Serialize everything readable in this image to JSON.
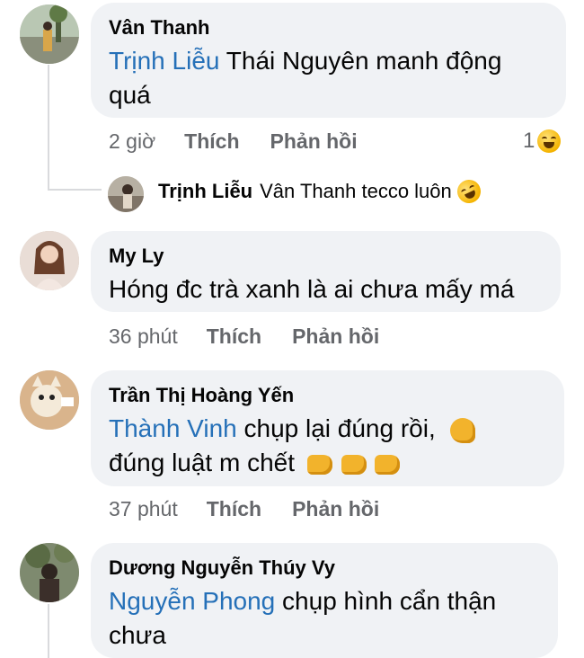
{
  "comments": [
    {
      "author": "Vân Thanh",
      "mention": "Trịnh Liễu",
      "text": "Thái Nguyên manh động quá",
      "time": "2 giờ",
      "like_label": "Thích",
      "reply_label": "Phản hồi",
      "reaction_count": "1",
      "reaction_icon": "laughing-emoji-icon"
    },
    {
      "author": "My Ly",
      "mention": "",
      "text": "Hóng đc trà xanh là ai chưa mấy má",
      "time": "36 phút",
      "like_label": "Thích",
      "reply_label": "Phản hồi"
    },
    {
      "author": "Trần Thị Hoàng Yến",
      "mention": "Thành Vinh",
      "text_line1": "chụp lại đúng rồi,",
      "text_line2": "đúng luật m chết",
      "time": "37 phút",
      "like_label": "Thích",
      "reply_label": "Phản hồi"
    },
    {
      "author": "Dương Nguyễn Thúy Vy",
      "mention": "Nguyễn Phong",
      "text_line1": "chụp hình cẩn thận",
      "text_line2": "chưa"
    }
  ],
  "reply": {
    "author": "Trịnh Liễu",
    "text": "Vân Thanh tecco luôn",
    "emoji_icon": "rolling-laughing-emoji-icon"
  }
}
